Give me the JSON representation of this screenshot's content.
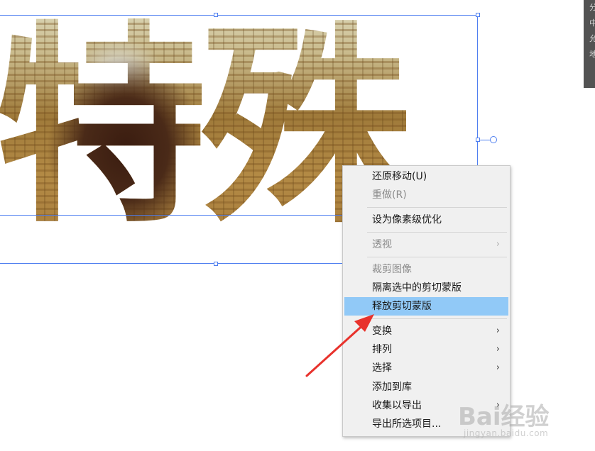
{
  "artwork": {
    "text": "特殊"
  },
  "side_panel": {
    "glyphs": [
      "分",
      "中",
      "允",
      "地"
    ]
  },
  "context_menu": {
    "items": [
      {
        "label": "还原移动(U)",
        "enabled": true,
        "submenu": false
      },
      {
        "label": "重做(R)",
        "enabled": false,
        "submenu": false
      },
      {
        "label": "设为像素级优化",
        "enabled": true,
        "submenu": false
      },
      {
        "label": "透视",
        "enabled": false,
        "submenu": true
      },
      {
        "label": "裁剪图像",
        "enabled": false,
        "submenu": false
      },
      {
        "label": "隔离选中的剪切蒙版",
        "enabled": true,
        "submenu": false
      },
      {
        "label": "释放剪切蒙版",
        "enabled": true,
        "submenu": false,
        "highlighted": true
      },
      {
        "label": "变换",
        "enabled": true,
        "submenu": true
      },
      {
        "label": "排列",
        "enabled": true,
        "submenu": true
      },
      {
        "label": "选择",
        "enabled": true,
        "submenu": true
      },
      {
        "label": "添加到库",
        "enabled": true,
        "submenu": false
      },
      {
        "label": "收集以导出",
        "enabled": true,
        "submenu": true
      },
      {
        "label": "导出所选项目...",
        "enabled": true,
        "submenu": false
      }
    ],
    "submenu_arrow": "›",
    "highlight_color": "#91c9f7"
  },
  "annotation": {
    "arrow_color": "#e8322c"
  },
  "watermark": {
    "brand": "Bai经验",
    "url": "jingyan.baidu.com"
  },
  "colors": {
    "selection": "#4f7ff0",
    "menu_bg": "#f0f0f0"
  }
}
